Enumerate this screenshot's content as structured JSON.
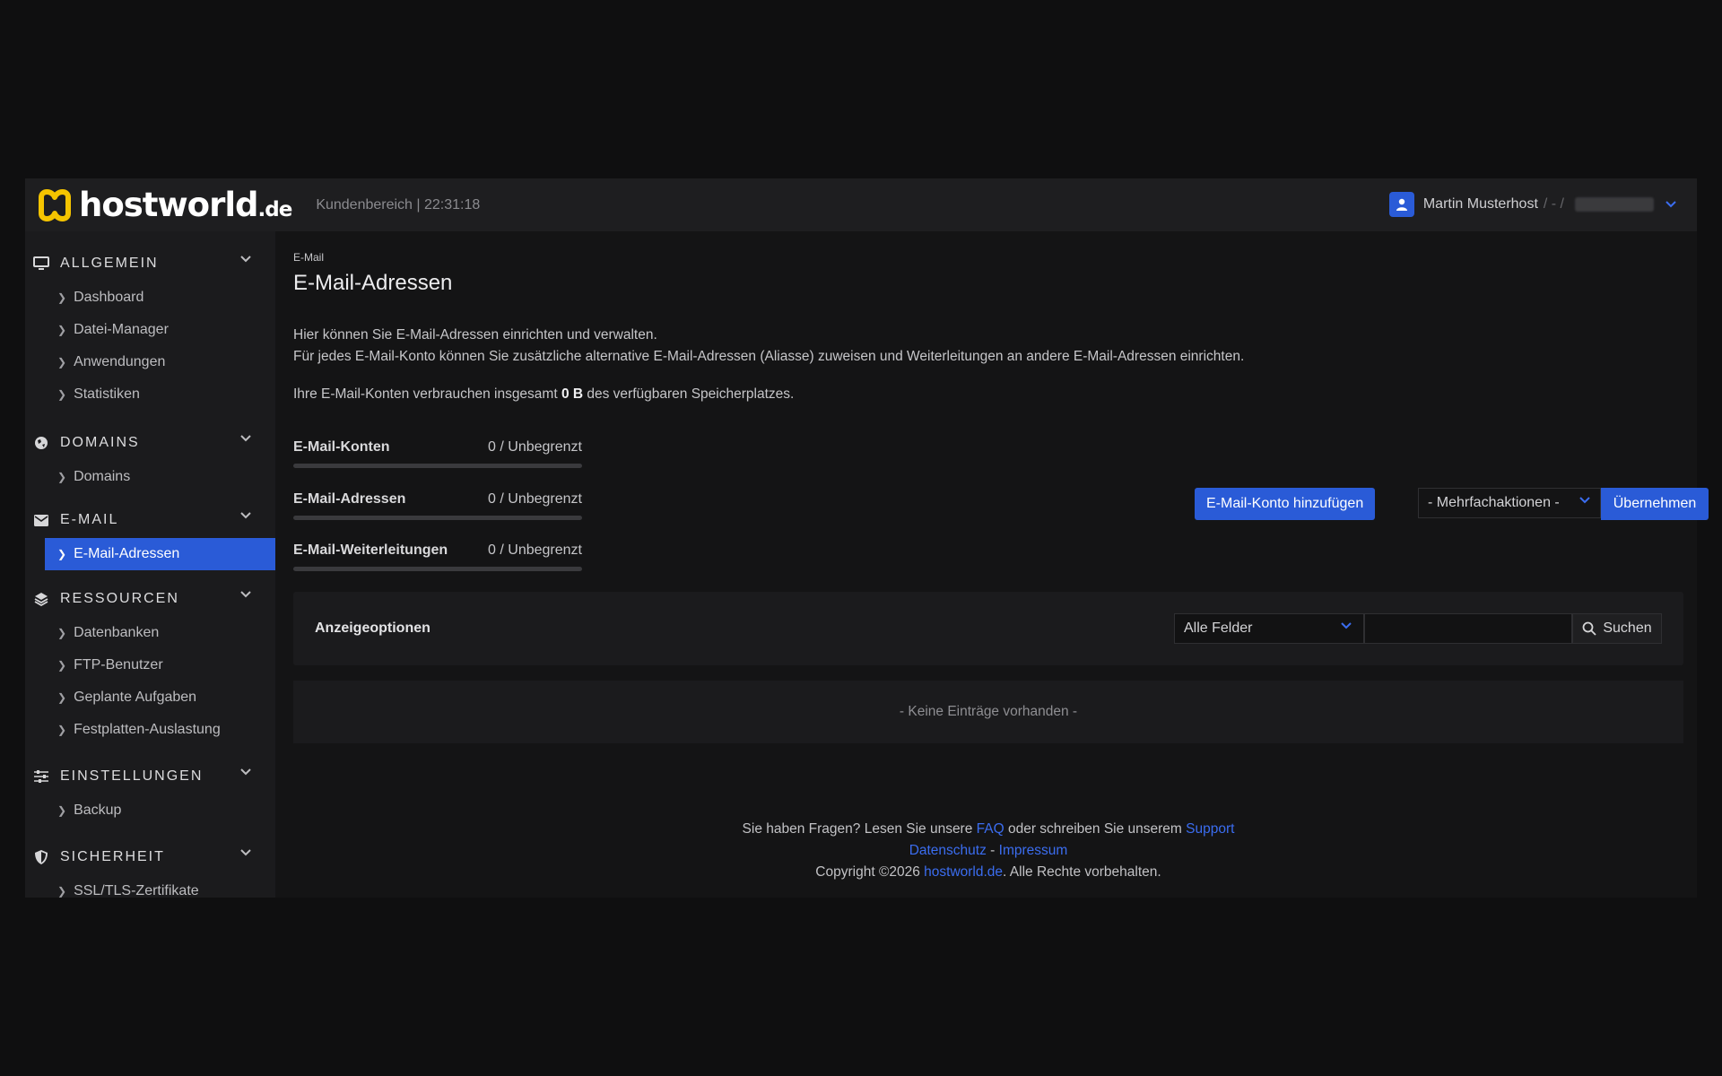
{
  "header": {
    "logo_text": "hostworld",
    "logo_tld": ".de",
    "subtitle": "Kundenbereich | 22:31:18",
    "user_name": "Martin Musterhost",
    "user_sep": "/ - /"
  },
  "sidebar": {
    "sections": [
      {
        "title": "ALLGEMEIN",
        "icon": "monitor-icon",
        "items": [
          "Dashboard",
          "Datei-Manager",
          "Anwendungen",
          "Statistiken"
        ]
      },
      {
        "title": "DOMAINS",
        "icon": "globe-icon",
        "items": [
          "Domains"
        ]
      },
      {
        "title": "E-MAIL",
        "icon": "envelope-icon",
        "items": [
          "E-Mail-Adressen"
        ]
      },
      {
        "title": "RESSOURCEN",
        "icon": "layers-icon",
        "items": [
          "Datenbanken",
          "FTP-Benutzer",
          "Geplante Aufgaben",
          "Festplatten-Auslastung"
        ]
      },
      {
        "title": "EINSTELLUNGEN",
        "icon": "sliders-icon",
        "items": [
          "Backup"
        ]
      },
      {
        "title": "SICHERHEIT",
        "icon": "shield-icon",
        "items": [
          "SSL/TLS-Zertifikate"
        ]
      }
    ],
    "active_item": "E-Mail-Adressen"
  },
  "main": {
    "breadcrumb": "E-Mail",
    "title": "E-Mail-Adressen",
    "intro_line1": "Hier können Sie E-Mail-Adressen einrichten und verwalten.",
    "intro_line2": "Für jedes E-Mail-Konto können Sie zusätzliche alternative E-Mail-Adressen (Aliasse) zuweisen und Weiterleitungen an andere E-Mail-Adressen einrichten.",
    "usage_prefix": "Ihre E-Mail-Konten verbrauchen insgesamt ",
    "usage_value": "0 B",
    "usage_suffix": " des verfügbaren Speicherplatzes.",
    "meters": [
      {
        "label": "E-Mail-Konten",
        "value": "0 / Unbegrenzt",
        "fill": 0
      },
      {
        "label": "E-Mail-Adressen",
        "value": "0 / Unbegrenzt",
        "fill": 0
      },
      {
        "label": "E-Mail-Weiterleitungen",
        "value": "0 / Unbegrenzt",
        "fill": 0
      }
    ],
    "add_button": "E-Mail-Konto hinzufügen",
    "bulk_select": "- Mehrfachaktionen -",
    "apply_button": "Übernehmen",
    "options_title": "Anzeigeoptionen",
    "field_select": "Alle Felder",
    "search_value": "",
    "search_button": "Suchen",
    "empty_text": "- Keine Einträge vorhanden -"
  },
  "footer": {
    "q_prefix": "Sie haben Fragen? Lesen Sie unsere ",
    "faq": "FAQ",
    "q_middle": " oder schreiben Sie unserem ",
    "support": "Support",
    "privacy": "Datenschutz",
    "sep": " - ",
    "imprint": "Impressum",
    "copy_prefix": "Copyright ©2026 ",
    "copy_link": "hostworld.de",
    "copy_suffix": ". Alle Rechte vorbehalten."
  },
  "colors": {
    "accent": "#2a5bd7",
    "link": "#3b6df0",
    "logo_yellow": "#f5c400"
  }
}
